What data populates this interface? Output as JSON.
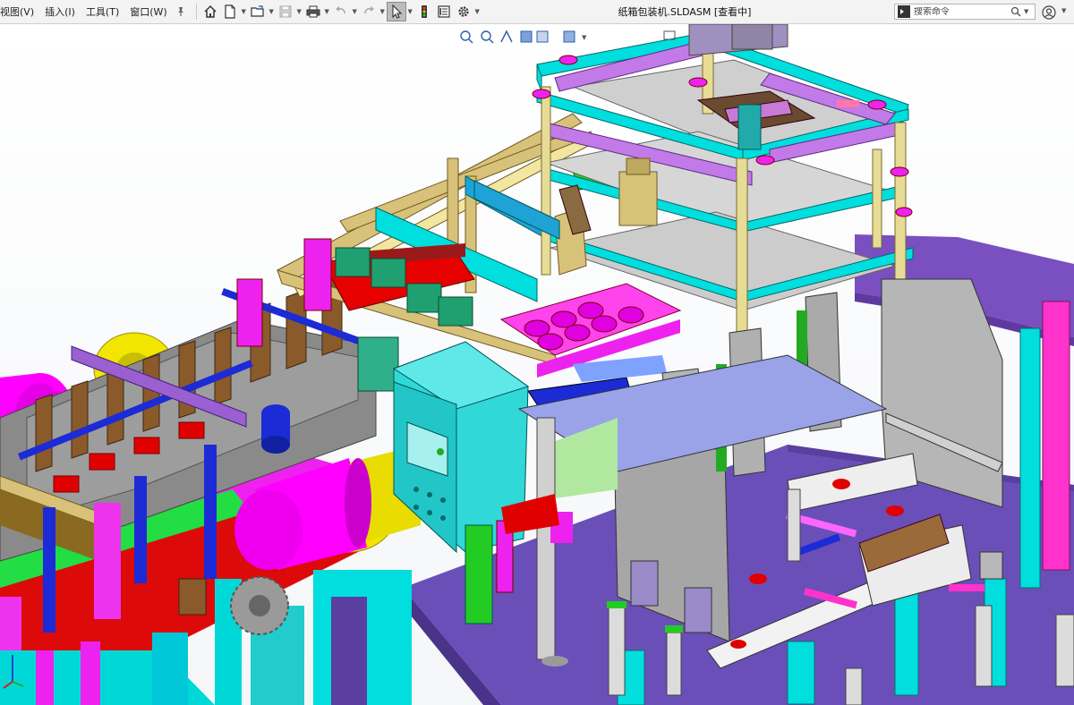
{
  "menu": {
    "items": [
      {
        "label": "视图(V)"
      },
      {
        "label": "插入(I)"
      },
      {
        "label": "工具(T)"
      },
      {
        "label": "窗口(W)"
      }
    ]
  },
  "toolbar": {
    "icons": [
      "home-icon",
      "new-document-icon",
      "open-folder-icon",
      "save-icon",
      "print-icon",
      "undo-icon",
      "redo-icon",
      "select-pointer-icon",
      "rebuild-traffic-light-icon",
      "file-properties-icon",
      "options-gear-icon"
    ]
  },
  "window": {
    "title": "纸箱包装机.SLDASM [查看中]"
  },
  "search": {
    "placeholder": "搜索命令"
  },
  "colors": {
    "magenta": "#ff00ff",
    "cyan": "#00e5e5",
    "violet": "#7a4fc0",
    "red": "#e00000",
    "yellow": "#f2e600",
    "brown": "#8a5a2b",
    "gray": "#9a9a9a",
    "navy": "#1c2bd6",
    "green": "#22cc22",
    "khaki": "#d8c27a"
  }
}
